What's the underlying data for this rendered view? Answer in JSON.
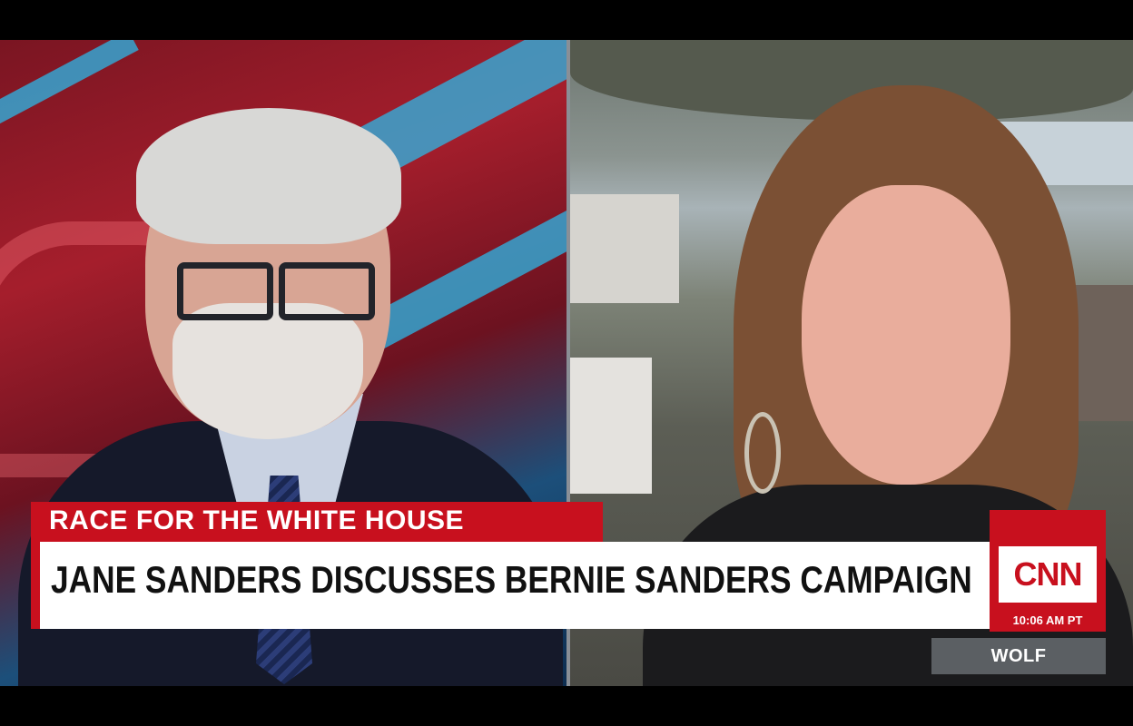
{
  "lower_third": {
    "kicker": "RACE FOR THE WHITE HOUSE",
    "headline": "JANE SANDERS DISCUSSES BERNIE SANDERS CAMPAIGN"
  },
  "network_bug": {
    "logo_text": "CNN",
    "time": "10:06 AM PT"
  },
  "show_tag": "WOLF",
  "colors": {
    "brand_red": "#c8101e",
    "headline_bg": "#ffffff",
    "show_tag_bg": "#5b5f63"
  },
  "icons": [
    "cnn-logo"
  ]
}
